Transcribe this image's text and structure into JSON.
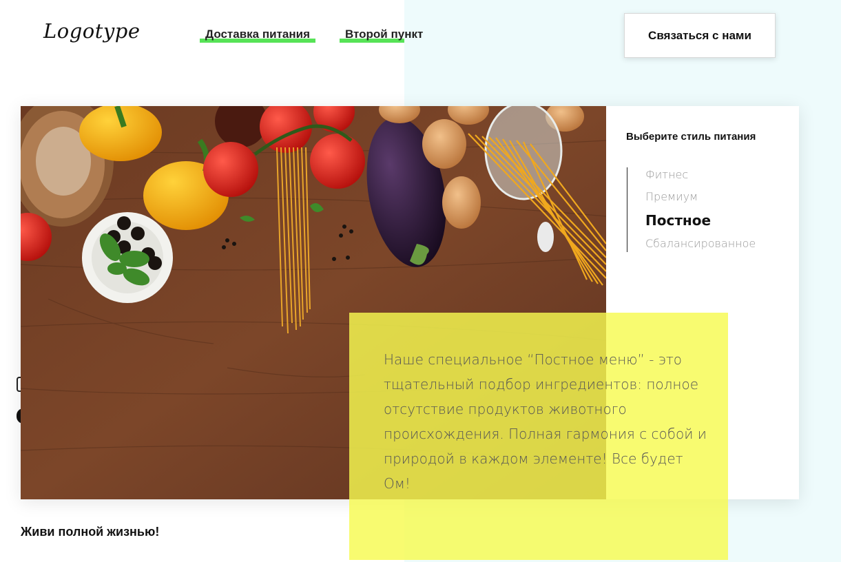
{
  "header": {
    "logo": "Logotype",
    "nav": [
      {
        "label": "Доставка питания"
      },
      {
        "label": "Второй пункт"
      }
    ],
    "contact_button": "Связаться с нами"
  },
  "sidebar": {
    "title": "Выберите стиль питания",
    "styles": [
      {
        "label": "Фитнес",
        "active": false
      },
      {
        "label": "Премиум",
        "active": false
      },
      {
        "label": "Постное",
        "active": true
      },
      {
        "label": "Сбалансированное",
        "active": false
      }
    ]
  },
  "promo": {
    "text": "Наше специальное “Постное меню” - это тщательный подбор ингредиентов: полное отсутствие продуктов животного происхождения. Полная гармония с собой и природой в каждом элементе! Все будет Ом!"
  },
  "tagline": "Живи полной жизнью!",
  "colors": {
    "accent_underline": "#57e357",
    "highlight_yellow": "#f6fa50",
    "page_right_bg": "#eefbfc"
  }
}
